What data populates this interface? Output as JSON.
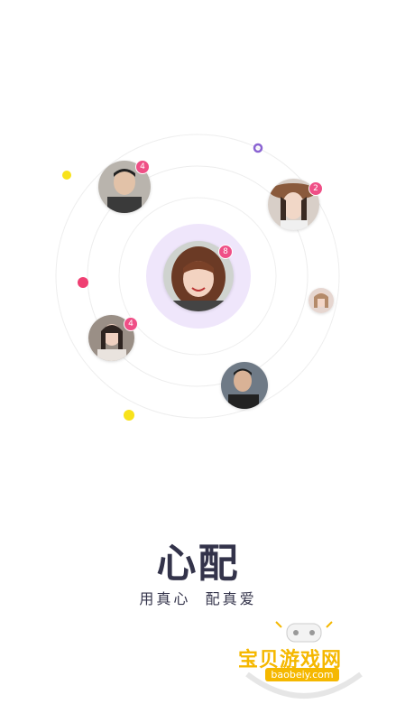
{
  "center_profile": {
    "badge": "8"
  },
  "profiles": [
    {
      "id": "top-left-man",
      "badge": "4"
    },
    {
      "id": "top-right-woman",
      "badge": "2"
    },
    {
      "id": "right-small-woman",
      "badge": ""
    },
    {
      "id": "left-woman",
      "badge": "4"
    },
    {
      "id": "bottom-man",
      "badge": ""
    }
  ],
  "title": "心配",
  "subtitle": "用真心  配真爱",
  "watermark": {
    "name": "宝贝游戏网",
    "url": "baobeiy.com"
  },
  "colors": {
    "halo": "#efe6fb",
    "badge": "#ef4f86",
    "dot_yellow": "#f8e21a",
    "dot_pink": "#ef3f72",
    "dot_purple": "#8a63d2",
    "title": "#33334a",
    "watermark": "#f5b800"
  }
}
